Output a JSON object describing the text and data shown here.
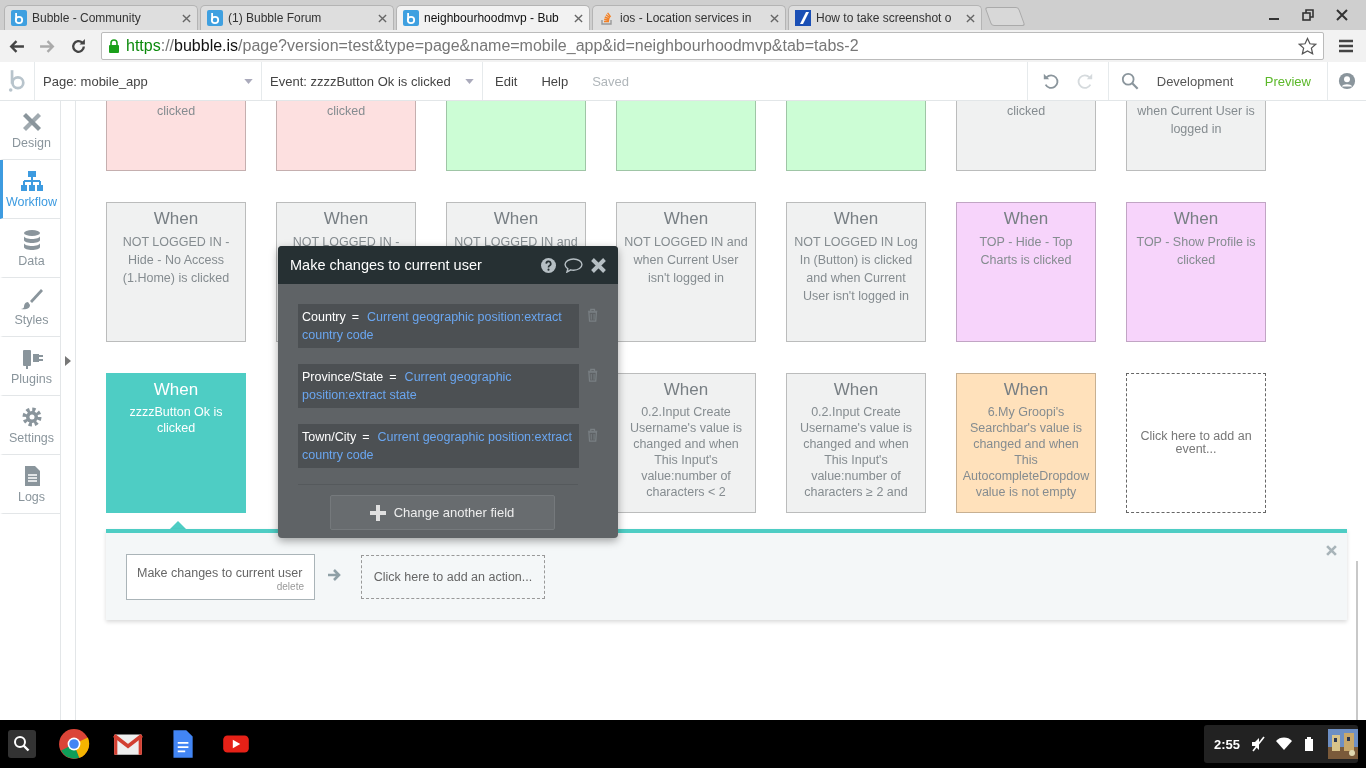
{
  "browser": {
    "tabs": [
      {
        "title": "Bubble - Community",
        "selected": false,
        "kind": "bubble"
      },
      {
        "title": "(1) Bubble Forum",
        "selected": false,
        "kind": "bubble"
      },
      {
        "title": "neighbourhoodmvp - Bub",
        "selected": true,
        "kind": "bubble"
      },
      {
        "title": "ios - Location services in",
        "selected": false,
        "kind": "stack"
      },
      {
        "title": "How to take screenshot o",
        "selected": false,
        "kind": "blue"
      }
    ],
    "url": {
      "scheme": "https",
      "sep": "://",
      "host": "bubble.is",
      "path": "/page?version=test&type=page&name=mobile_app&id=neighbourhoodmvp&tab=tabs-2"
    }
  },
  "toolbar": {
    "page": "Page: mobile_app",
    "event": "Event: zzzzButton Ok is clicked",
    "menu": [
      {
        "label": "Edit",
        "disabled": false
      },
      {
        "label": "Help",
        "disabled": false
      },
      {
        "label": "Saved",
        "disabled": true
      }
    ],
    "mode": "Development",
    "preview": "Preview"
  },
  "sidebar": {
    "items": [
      {
        "label": "Design",
        "selected": false
      },
      {
        "label": "Workflow",
        "selected": true
      },
      {
        "label": "Data",
        "selected": false
      },
      {
        "label": "Styles",
        "selected": false
      },
      {
        "label": "Plugins",
        "selected": false
      },
      {
        "label": "Settings",
        "selected": false
      },
      {
        "label": "Logs",
        "selected": false
      }
    ]
  },
  "events": {
    "rows": [
      [
        {
          "kind": "event",
          "text": "clicked",
          "color": "#fde0e0",
          "selected": false
        },
        {
          "kind": "event",
          "text": "clicked",
          "color": "#fde0e0",
          "selected": false
        },
        {
          "kind": "event",
          "color": "#ccfdd5",
          "selected": false
        },
        {
          "kind": "event",
          "color": "#ccfdd5",
          "selected": false
        },
        {
          "kind": "event",
          "color": "#ccfdd5",
          "selected": false
        },
        {
          "kind": "event",
          "text": "clicked",
          "color": "#f0f1f1",
          "selected": false
        },
        {
          "kind": "event",
          "text": "when Current User is logged in",
          "color": "#f0f1f1",
          "selected": false
        }
      ],
      [
        {
          "kind": "event",
          "when": "When",
          "text": "NOT LOGGED IN - Hide - No Access (1.Home) is clicked",
          "color": "#f0f1f1",
          "selected": false
        },
        {
          "kind": "event",
          "when": "When",
          "text": "NOT LOGGED IN -",
          "color": "#f0f1f1",
          "selected": false
        },
        {
          "kind": "event",
          "when": "When",
          "text": "NOT LOGGED IN and",
          "color": "#f0f1f1",
          "selected": false
        },
        {
          "kind": "event",
          "when": "When",
          "text": "NOT LOGGED IN and when Current User isn't logged in",
          "color": "#f0f1f1",
          "selected": false
        },
        {
          "kind": "event",
          "when": "When",
          "text": "NOT LOGGED IN Log In (Button) is clicked and when Current User isn't logged in",
          "color": "#f0f1f1",
          "selected": false
        },
        {
          "kind": "event",
          "when": "When",
          "text": "TOP - Hide - Top Charts is clicked",
          "color": "#f7d4fb",
          "selected": false
        },
        {
          "kind": "event",
          "when": "When",
          "text": "TOP - Show Profile is clicked",
          "color": "#f7d4fb",
          "selected": false
        }
      ],
      [
        {
          "kind": "event",
          "when": "When",
          "text": "zzzzButton Ok is clicked",
          "color": "#4ecdc4",
          "selected": true
        },
        {
          "kind": "covered"
        },
        {
          "kind": "covered"
        },
        {
          "kind": "event",
          "when": "When",
          "text": "0.2.Input Create Username's value is changed and when This Input's value:number of characters < 2",
          "color": "#f0f1f1",
          "selected": false
        },
        {
          "kind": "event",
          "when": "When",
          "text": "0.2.Input Create Username's value is changed and when This Input's value:number of characters ≥ 2 and",
          "color": "#f0f1f1",
          "selected": false
        },
        {
          "kind": "event",
          "when": "When",
          "text": "6.My Groopi's Searchbar's value is changed and when This AutocompleteDropdow value is not empty",
          "color": "#ffe1bb",
          "selected": false
        },
        {
          "kind": "add",
          "text": "Click here to add an event..."
        }
      ]
    ]
  },
  "popup": {
    "title": "Make changes to current user",
    "fields": [
      {
        "name": "Country",
        "eq": "=",
        "value": "Current geographic position:extract country code"
      },
      {
        "name": "Province/State",
        "eq": "=",
        "value": "Current geographic position:extract state"
      },
      {
        "name": "Town/City",
        "eq": "=",
        "value": "Current geographic position:extract country code"
      }
    ],
    "button": "Change another field"
  },
  "actions": {
    "steps": [
      {
        "label": "Make changes to current user",
        "delete": "delete"
      }
    ],
    "add": "Click here to add an action..."
  },
  "taskbar": {
    "time": "2:55"
  }
}
